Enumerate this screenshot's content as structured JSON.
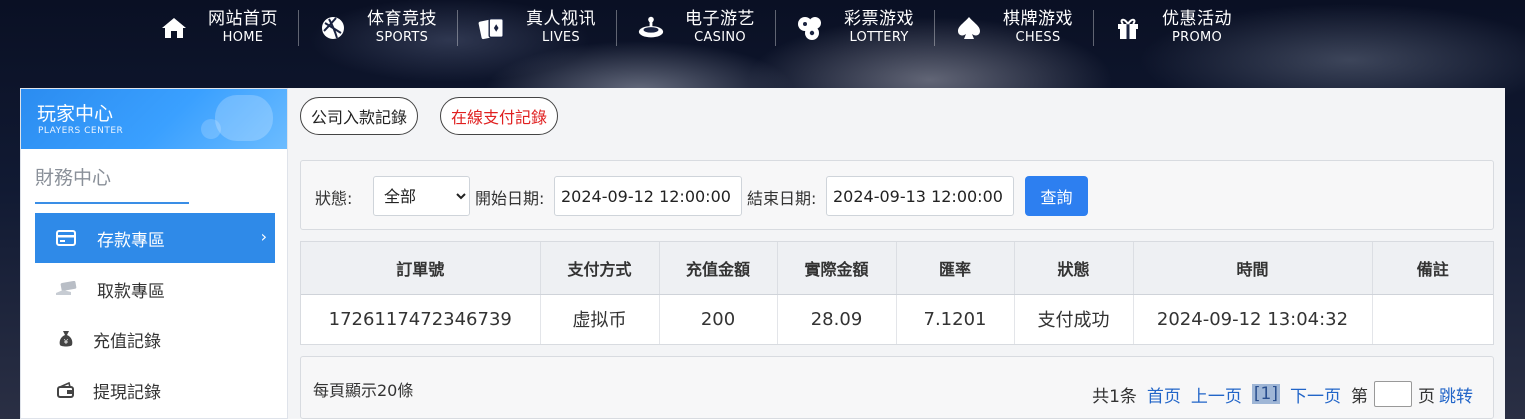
{
  "nav": [
    {
      "cn": "网站首页",
      "en": "HOME",
      "icon": "home-icon"
    },
    {
      "cn": "体育竞技",
      "en": "SPORTS",
      "icon": "ball-icon"
    },
    {
      "cn": "真人视讯",
      "en": "LIVES",
      "icon": "cards-icon"
    },
    {
      "cn": "电子游艺",
      "en": "CASINO",
      "icon": "slot-icon"
    },
    {
      "cn": "彩票游戏",
      "en": "LOTTERY",
      "icon": "lottery-balls-icon"
    },
    {
      "cn": "棋牌游戏",
      "en": "CHESS",
      "icon": "spade-icon"
    },
    {
      "cn": "优惠活动",
      "en": "PROMO",
      "icon": "gift-icon"
    }
  ],
  "sidebar": {
    "title": "玩家中心",
    "subtitle": "PLAYERS CENTER",
    "section": "財務中心",
    "items": [
      {
        "label": "存款專區",
        "icon": "card-icon",
        "active": true
      },
      {
        "label": "取款專區",
        "icon": "cash-icon",
        "active": false
      },
      {
        "label": "充值記錄",
        "icon": "money-bag-icon",
        "active": false
      },
      {
        "label": "提現記錄",
        "icon": "wallet-icon",
        "active": false
      }
    ]
  },
  "tabs": {
    "company": "公司入款記錄",
    "online": "在線支付記錄"
  },
  "filter": {
    "status_label": "狀態:",
    "status_value": "全部",
    "start_label": "開始日期:",
    "start_value": "2024-09-12 12:00:00",
    "end_label": "結束日期:",
    "end_value": "2024-09-13 12:00:00",
    "search_label": "查詢"
  },
  "table": {
    "headers": [
      "訂單號",
      "支付方式",
      "充值金額",
      "實際金額",
      "匯率",
      "狀態",
      "時間",
      "備註"
    ],
    "rows": [
      [
        "1726117472346739",
        "虚拟币",
        "200",
        "28.09",
        "7.1201",
        "支付成功",
        "2024-09-12 13:04:32",
        ""
      ]
    ]
  },
  "pager": {
    "per_page": "每頁顯示20條",
    "total": "共1条",
    "first": "首页",
    "prev": "上一页",
    "current": "[1]",
    "next": "下一页",
    "goto_prefix": "第",
    "goto_suffix": "页",
    "jump": "跳转"
  },
  "colors": {
    "accent": "#2f8ae8",
    "link": "#2265c8",
    "tab_red": "#e02020"
  }
}
